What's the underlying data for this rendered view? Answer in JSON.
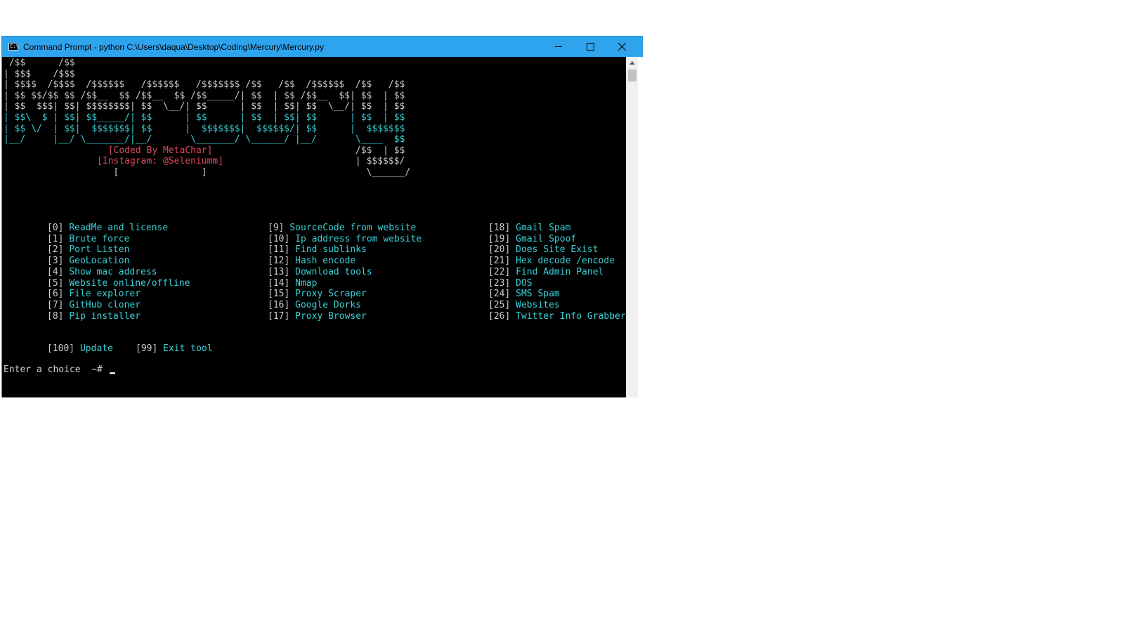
{
  "window": {
    "title": "Command Prompt - python  C:\\Users\\daqua\\Desktop\\Coding\\Mercury\\Mercury.py",
    "icon_text": "C:\\",
    "controls": [
      "minimize-icon",
      "maximize-icon",
      "close-icon"
    ]
  },
  "banner": {
    "lines": [
      [
        {
          "t": " /$$      /$$",
          "c": "w"
        }
      ],
      [
        {
          "t": "| $$$    /$$$",
          "c": "w"
        }
      ],
      [
        {
          "t": "| $$$$  /$$$$  /$$$$$$   /$$$$$$   /$$$$$$$ /$$   /$$  /$$$$$$  /$$   /$$",
          "c": "w"
        }
      ],
      [
        {
          "t": "| $$ $$/$$ $$ /$$__  $$ /$$__  $$ /$$_____/| $$  | $$ /$$__  $$| $$  | $$",
          "c": "w"
        }
      ],
      [
        {
          "t": "| $$  $$$| $$| $$$$$$$$| $$  \\__/| $$      | $$  | $$| $$  \\__/| $$  | $$",
          "c": "w"
        }
      ],
      [
        {
          "t": "| $$\\  $ | $$| $$_____/| $$      | $$      | $$  | $$| $$      | $$  | $$",
          "c": "c"
        }
      ],
      [
        {
          "t": "| $$ \\/  | $$|  $$$$$$$| $$      |  $$$$$$$|  $$$$$$/| $$      |  $$$$$$$",
          "c": "c"
        }
      ],
      [
        {
          "t": "|__/     |__/ \\_______/|__/       \\_______/ \\______/ |__/       \\____  $$",
          "c": "c"
        }
      ],
      [
        {
          "t": "                   ",
          "c": "w"
        },
        {
          "t": "[Coded By MetaChar]",
          "c": "r"
        },
        {
          "t": "                          /$$  | $$",
          "c": "w"
        }
      ],
      [
        {
          "t": "                 ",
          "c": "w"
        },
        {
          "t": "[Instagram: @Seleniumm]",
          "c": "r"
        },
        {
          "t": "                        | $$$$$$/",
          "c": "w"
        }
      ],
      [
        {
          "t": "                    [               ]                             \\______/",
          "c": "w"
        }
      ]
    ]
  },
  "menu": {
    "columns": [
      [
        {
          "num": "[0]",
          "label": "ReadMe and license"
        },
        {
          "num": "[1]",
          "label": "Brute force"
        },
        {
          "num": "[2]",
          "label": "Port Listen"
        },
        {
          "num": "[3]",
          "label": "GeoLocation"
        },
        {
          "num": "[4]",
          "label": "Show mac address"
        },
        {
          "num": "[5]",
          "label": "Website online/offline"
        },
        {
          "num": "[6]",
          "label": "File explorer"
        },
        {
          "num": "[7]",
          "label": "GitHub cloner"
        },
        {
          "num": "[8]",
          "label": "Pip installer"
        }
      ],
      [
        {
          "num": "[9]",
          "label": "SourceCode from website"
        },
        {
          "num": "[10]",
          "label": "Ip address from website"
        },
        {
          "num": "[11]",
          "label": "Find sublinks"
        },
        {
          "num": "[12]",
          "label": "Hash encode"
        },
        {
          "num": "[13]",
          "label": "Download tools"
        },
        {
          "num": "[14]",
          "label": "Nmap"
        },
        {
          "num": "[15]",
          "label": "Proxy Scraper"
        },
        {
          "num": "[16]",
          "label": "Google Dorks"
        },
        {
          "num": "[17]",
          "label": "Proxy Browser"
        }
      ],
      [
        {
          "num": "[18]",
          "label": "Gmail Spam"
        },
        {
          "num": "[19]",
          "label": "Gmail Spoof"
        },
        {
          "num": "[20]",
          "label": "Does Site Exist"
        },
        {
          "num": "[21]",
          "label": "Hex decode /encode"
        },
        {
          "num": "[22]",
          "label": "Find Admin Panel"
        },
        {
          "num": "[23]",
          "label": "DOS"
        },
        {
          "num": "[24]",
          "label": "SMS Spam"
        },
        {
          "num": "[25]",
          "label": "Websites"
        },
        {
          "num": "[26]",
          "label": "Twitter Info Grabber"
        }
      ]
    ],
    "extra": [
      {
        "num": "[100]",
        "label": "Update"
      },
      {
        "num": "[99]",
        "label": "Exit tool"
      }
    ]
  },
  "prompt": {
    "text": "Enter a choice  ~#"
  },
  "colors": {
    "cyan": "#3ad0d6",
    "red": "#e0475e",
    "gray": "#cccccc",
    "titlebar": "#2fa4ee"
  }
}
